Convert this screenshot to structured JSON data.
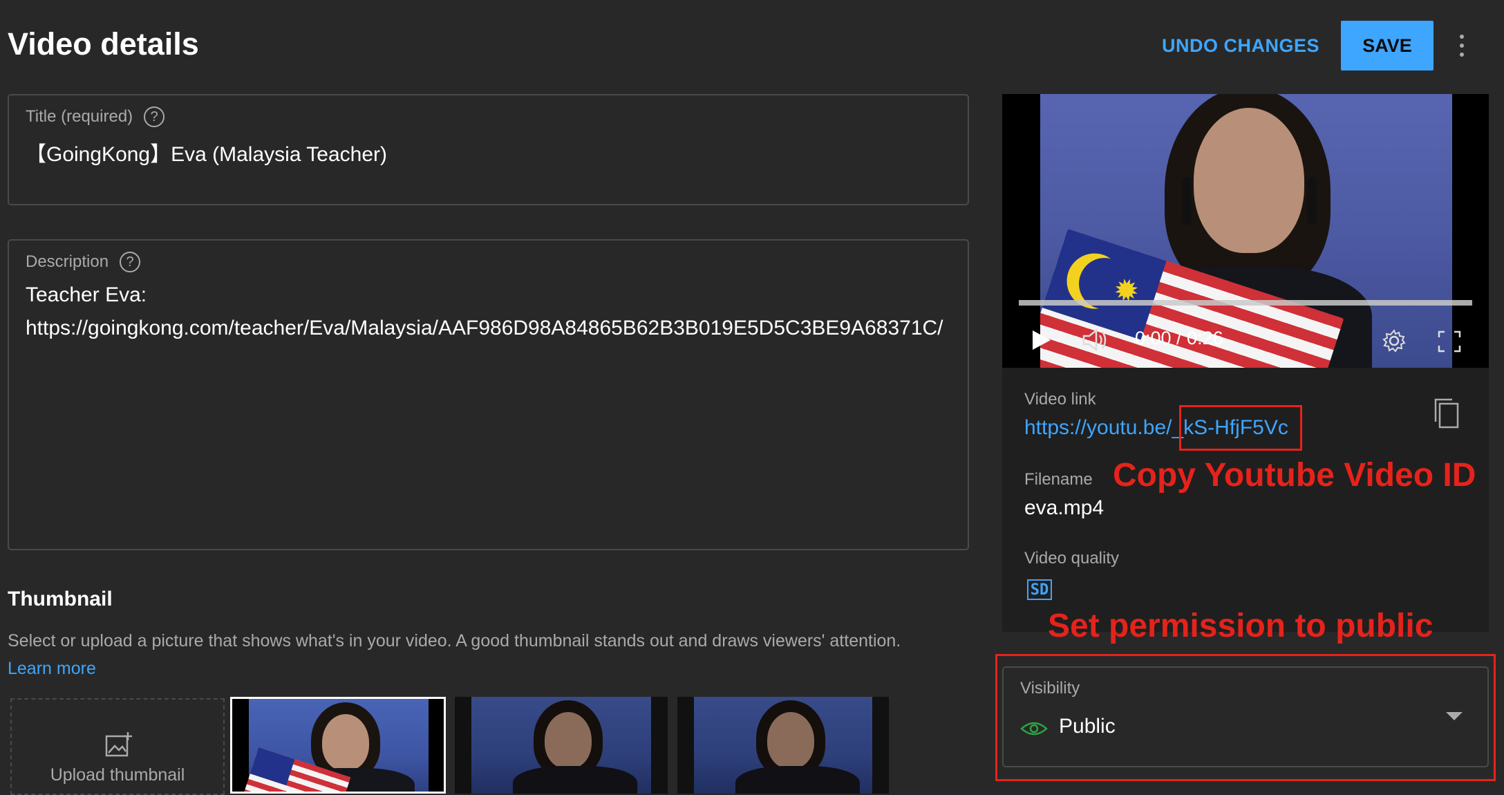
{
  "header": {
    "title": "Video details",
    "undo_label": "UNDO CHANGES",
    "save_label": "SAVE"
  },
  "title_field": {
    "label": "Title (required)",
    "value": "【GoingKong】Eva (Malaysia Teacher)"
  },
  "description_field": {
    "label": "Description",
    "line1": "Teacher Eva:",
    "line2": "https://goingkong.com/teacher/Eva/Malaysia/AAF986D98A84865B62B3B019E5D5C3BE9A68371C/"
  },
  "thumbnail": {
    "heading": "Thumbnail",
    "description": "Select or upload a picture that shows what's in your video. A good thumbnail stands out and draws viewers' attention.",
    "learn_more": "Learn more",
    "upload_label": "Upload thumbnail"
  },
  "player": {
    "time": "0:00 / 0:26",
    "progress": 0
  },
  "video_info": {
    "link_label": "Video link",
    "link_prefix": "https://youtu.be/",
    "link_id": "_kS-HfjF5Vc",
    "filename_label": "Filename",
    "filename": "eva.mp4",
    "quality_label": "Video quality",
    "quality_badge": "SD"
  },
  "visibility": {
    "label": "Visibility",
    "value": "Public"
  },
  "annotations": {
    "copy_id": "Copy Youtube Video ID",
    "set_public": "Set permission to public",
    "color": "#e5231b"
  },
  "colors": {
    "accent": "#3ea6ff",
    "background": "#282828",
    "visibility_eye": "#2ba640"
  }
}
